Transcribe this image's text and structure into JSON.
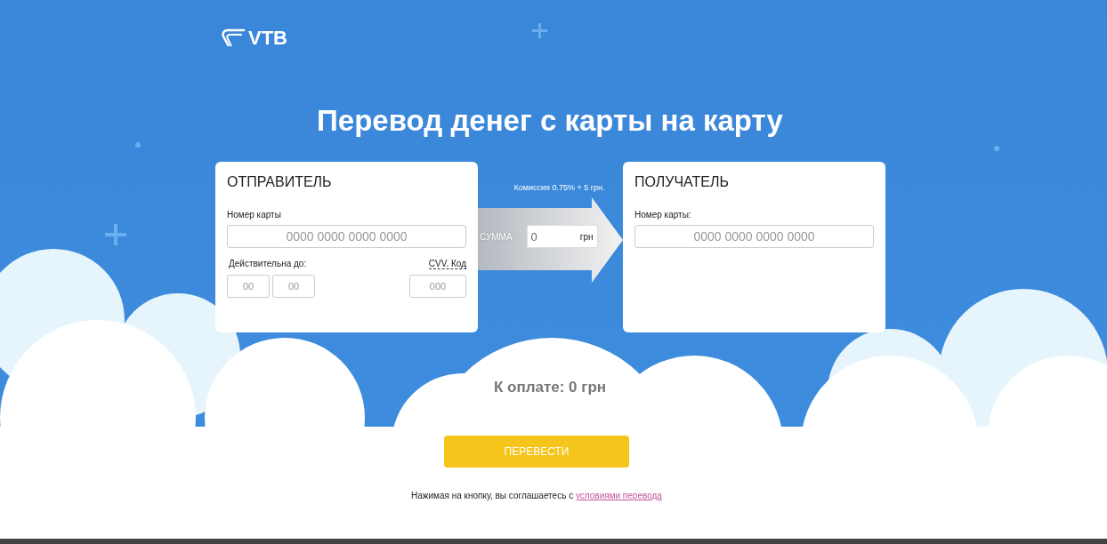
{
  "logo": {
    "text": "VTB"
  },
  "title": "Перевод денег с карты на карту",
  "sender": {
    "heading": "ОТПРАВИТЕЛЬ",
    "card_label": "Номер карты",
    "card_placeholder": "0000 0000 0000 0000",
    "expiry_label": "Действительна до:",
    "month_placeholder": "00",
    "year_placeholder": "00",
    "cvv_label": "CVV. Код",
    "cvv_placeholder": "000"
  },
  "transfer": {
    "commission": "Комиссия 0.75% + 5 грн.",
    "amount_label": "СУММА",
    "amount": {
      "value": "0",
      "currency": "грн"
    }
  },
  "recipient": {
    "heading": "ПОЛУЧАТЕЛЬ",
    "card_label": "Номер карты:",
    "card_placeholder": "0000 0000 0000 0000"
  },
  "total": "К оплате: 0 грн",
  "submit_button": "ПЕРЕВЕСТИ",
  "agreement": {
    "text": "Нажимая на кнопку, вы соглашаетесь с",
    "link": "условиями перевода"
  }
}
